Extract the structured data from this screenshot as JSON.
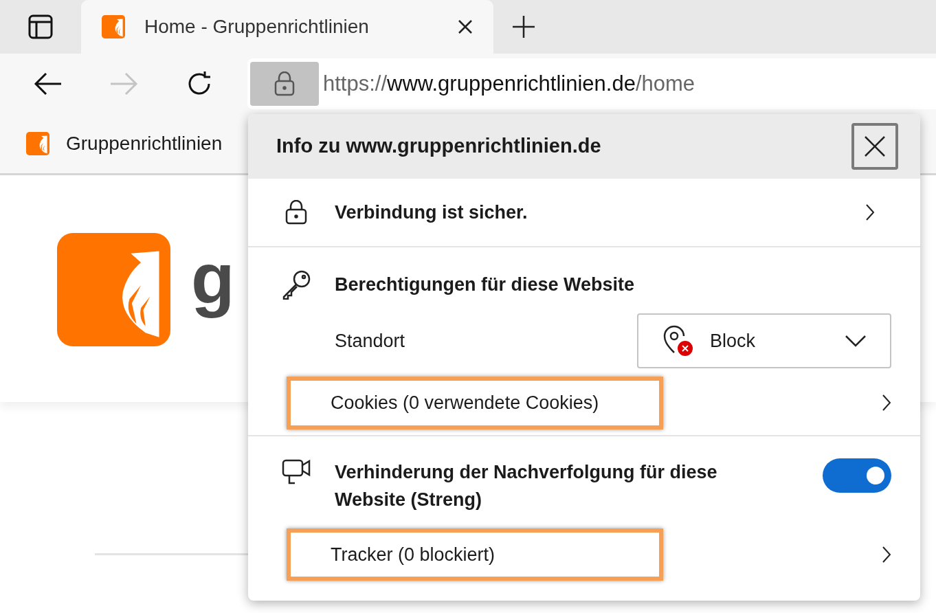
{
  "tabs": [
    {
      "title": "Home - Gruppenrichtlinien",
      "selected": true
    }
  ],
  "toolbar": {
    "forward_disabled": true
  },
  "address": {
    "scheme": "https://",
    "host": "www.gruppenrichtlinien.de",
    "path": "/home"
  },
  "bookmarks": [
    {
      "label": "Gruppenrichtlinien"
    }
  ],
  "page": {
    "logo_text": "g"
  },
  "popup": {
    "title": "Info zu www.gruppenrichtlinien.de",
    "connection": "Verbindung ist sicher.",
    "permissions": {
      "title": "Berechtigungen für diese Website",
      "location_label": "Standort",
      "location_value": "Block",
      "cookies": "Cookies (0 verwendete Cookies)",
      "cookies_highlighted": true
    },
    "tracking": {
      "title": "Verhinderung der Nachverfolgung für diese Website (Streng)",
      "on": true,
      "trackers": "Tracker (0 blockiert)",
      "trackers_highlighted": true
    }
  }
}
